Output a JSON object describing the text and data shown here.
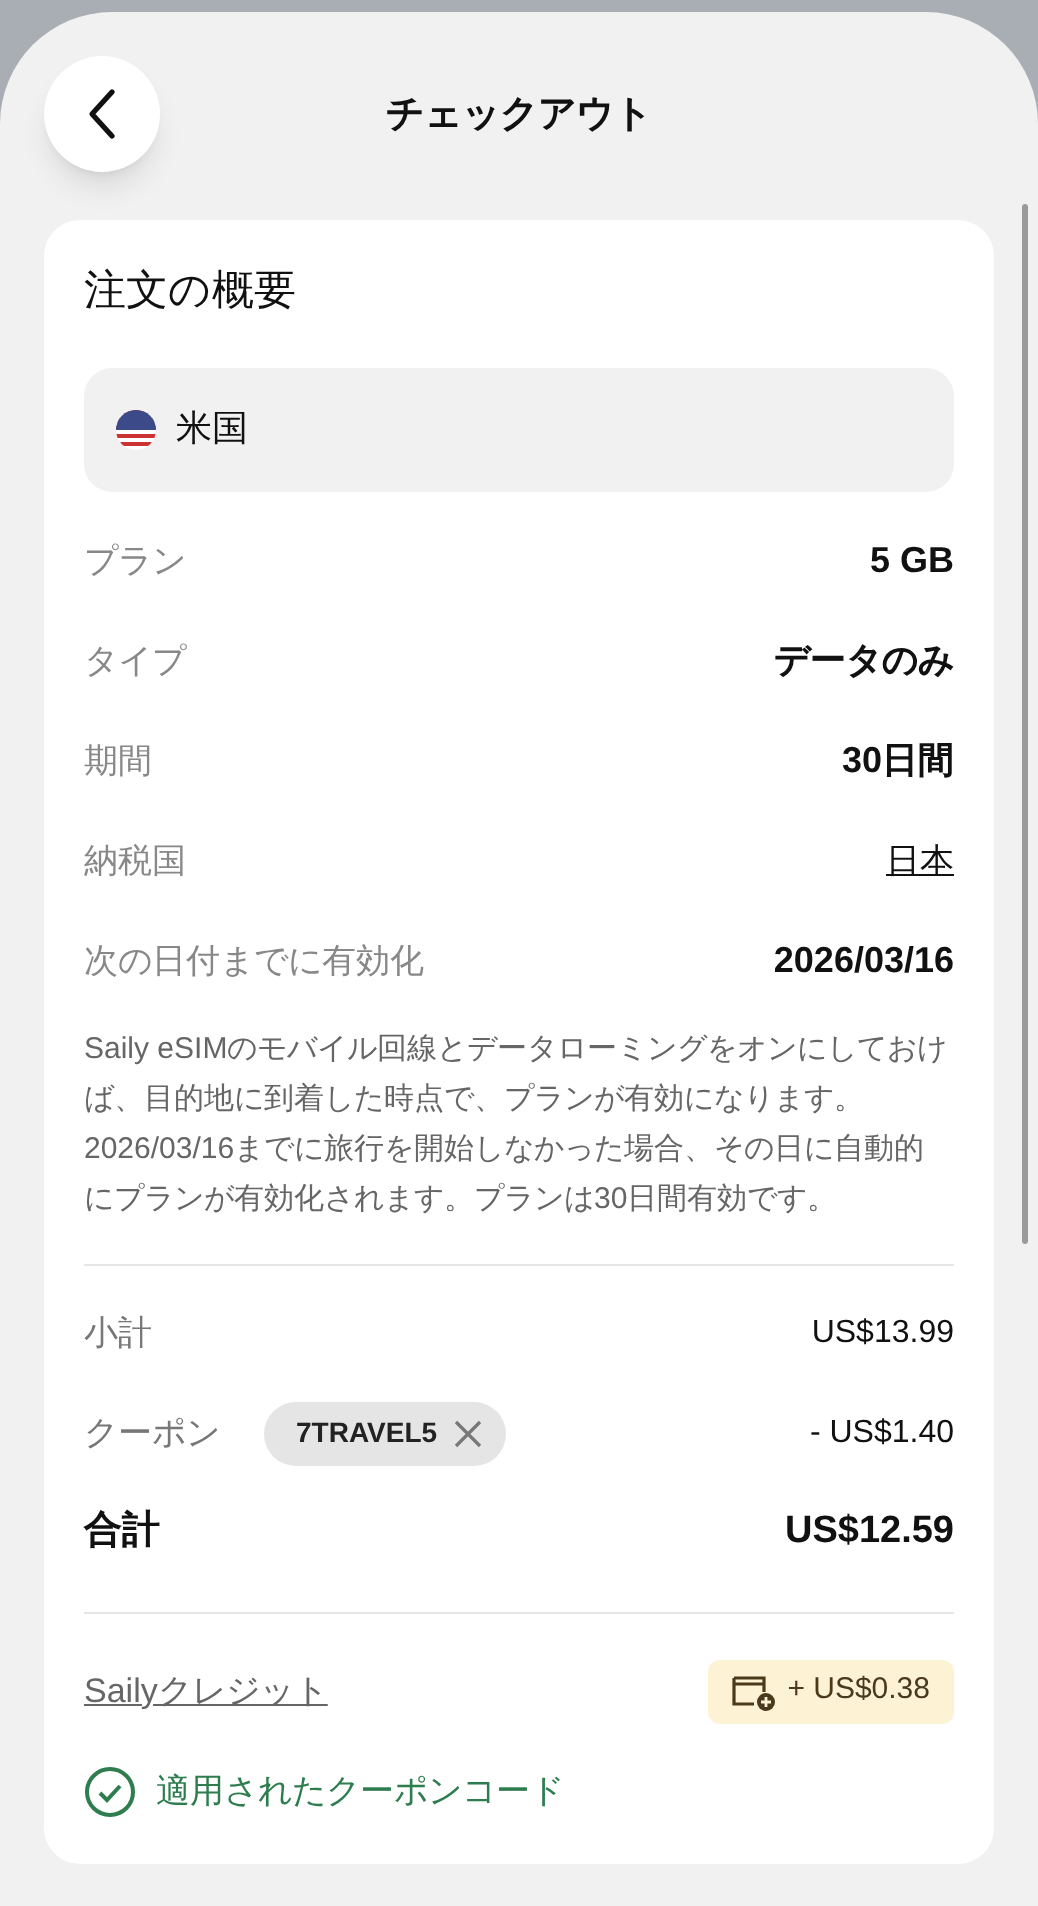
{
  "header": {
    "title": "チェックアウト"
  },
  "summary": {
    "title": "注文の概要",
    "country": "米国",
    "details": [
      {
        "label": "プラン",
        "value": "5 GB",
        "kind": "plain"
      },
      {
        "label": "タイプ",
        "value": "データのみ",
        "kind": "plain"
      },
      {
        "label": "期間",
        "value": "30日間",
        "kind": "plain"
      },
      {
        "label": "納税国",
        "value": "日本",
        "kind": "link"
      },
      {
        "label": "次の日付までに有効化",
        "value": "2026/03/16",
        "kind": "plain"
      }
    ],
    "note": "Saily eSIMのモバイル回線とデータローミングをオンにしておけば、目的地に到着した時点で、プランが有効になります。2026/03/16までに旅行を開始しなかった場合、その日に自動的にプランが有効化されます。プランは30日間有効です。",
    "subtotal": {
      "label": "小計",
      "value": "US$13.99"
    },
    "coupon": {
      "label": "クーポン",
      "code": "7TRAVEL5",
      "value": "- US$1.40"
    },
    "total": {
      "label": "合計",
      "value": "US$12.59"
    },
    "credit": {
      "label": "Sailyクレジット",
      "value": "+ US$0.38"
    },
    "applied": {
      "text": "適用されたクーポンコード"
    }
  }
}
